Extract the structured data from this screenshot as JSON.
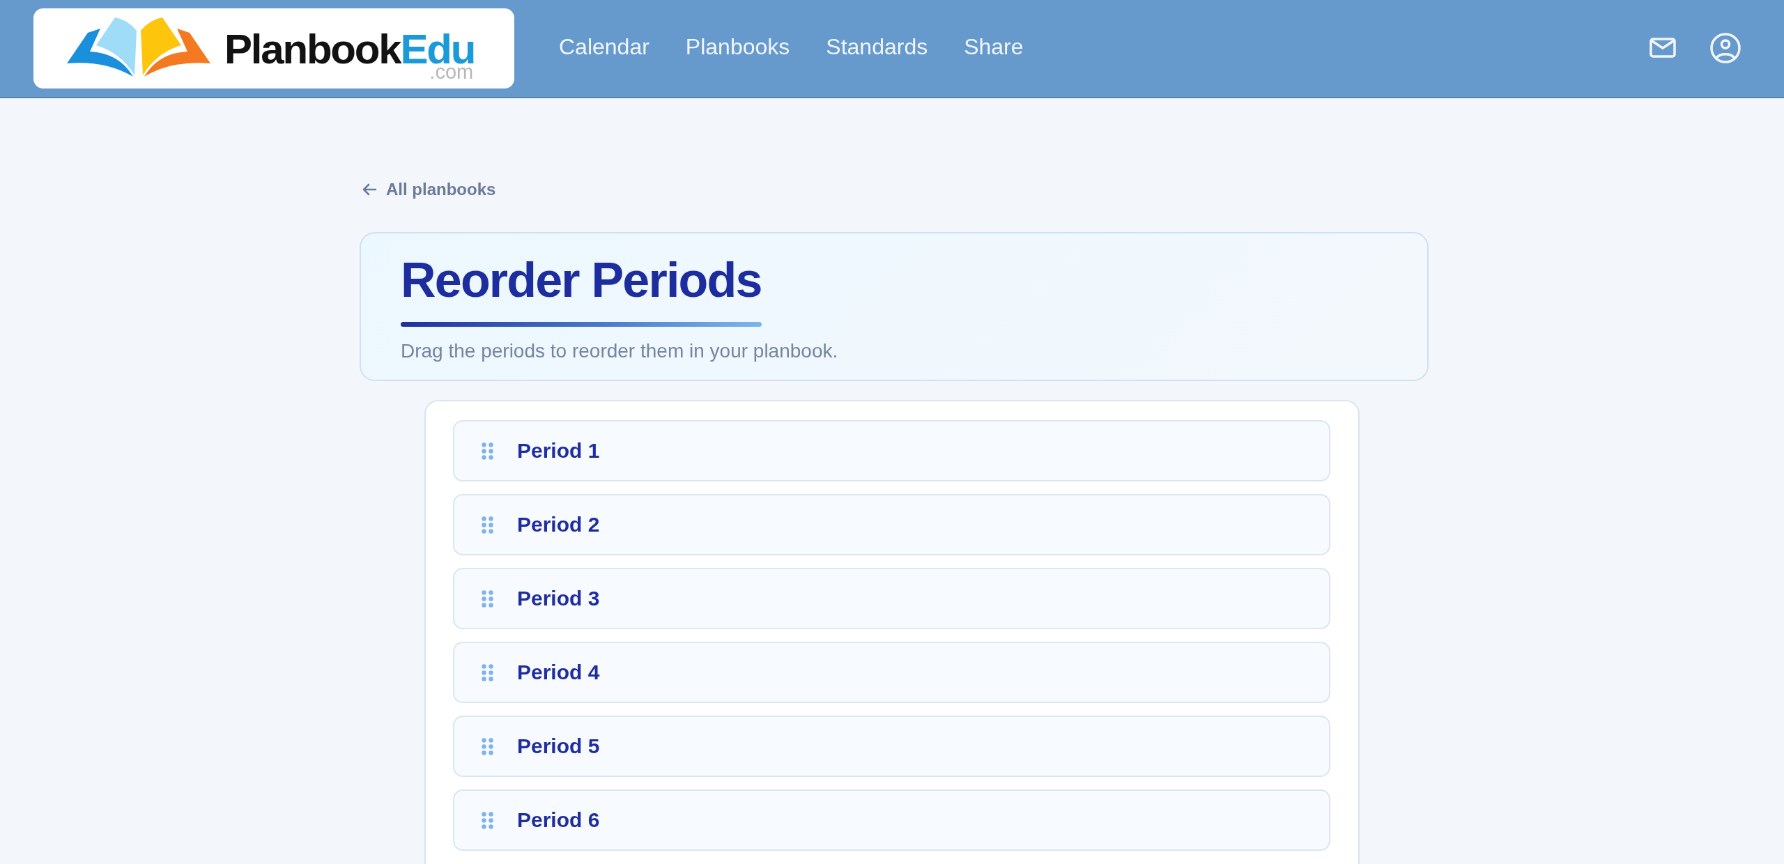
{
  "header": {
    "logo": {
      "wordmark": "Planbook",
      "wordmark_accent": "Edu",
      "domain": ".com"
    },
    "nav": [
      "Calendar",
      "Planbooks",
      "Standards",
      "Share"
    ]
  },
  "back_link": "All planbooks",
  "title_card": {
    "title": "Reorder Periods",
    "subtitle": "Drag the periods to reorder them in your planbook."
  },
  "periods": [
    "Period 1",
    "Period 2",
    "Period 3",
    "Period 4",
    "Period 5",
    "Period 6"
  ]
}
